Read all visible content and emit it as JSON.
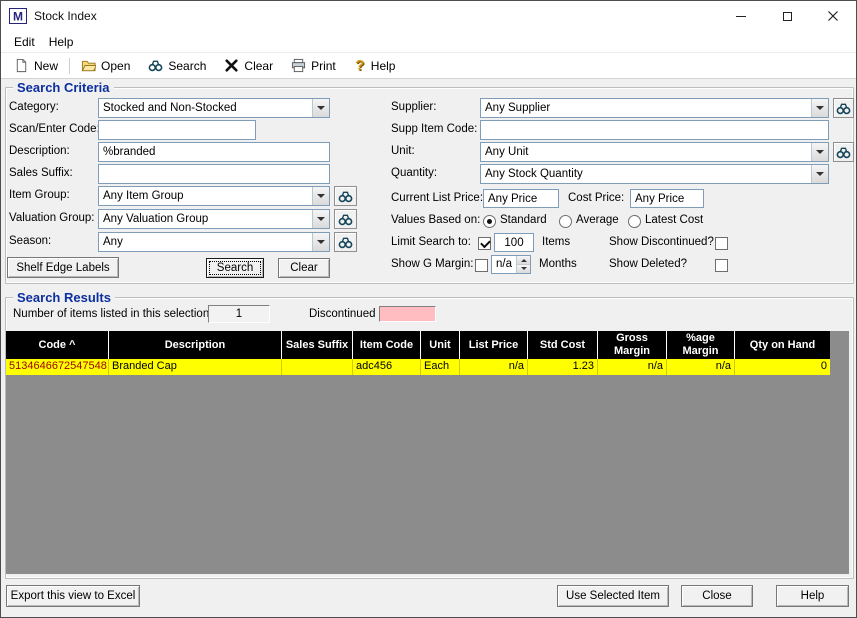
{
  "colors": {
    "title_blue": "#0b2fa0",
    "header_bg": "#000000",
    "row_highlight": "#ffff00",
    "code_text": "#9b0000",
    "discontinued": "#ffbdc2",
    "empty_area": "#8c8c8c"
  },
  "window": {
    "title": "Stock Index"
  },
  "menu": {
    "edit": "Edit",
    "help": "Help"
  },
  "toolbar": {
    "new": "New",
    "open": "Open",
    "search": "Search",
    "clear": "Clear",
    "print": "Print",
    "help": "Help"
  },
  "criteria": {
    "title": "Search Criteria",
    "category_label": "Category:",
    "category_value": "Stocked and Non-Stocked",
    "scan_label": "Scan/Enter Code:",
    "scan_value": "",
    "description_label": "Description:",
    "description_value": "%branded",
    "sales_suffix_label": "Sales Suffix:",
    "sales_suffix_value": "",
    "item_group_label": "Item Group:",
    "item_group_value": "Any Item Group",
    "valuation_group_label": "Valuation Group:",
    "valuation_group_value": "Any Valuation Group",
    "season_label": "Season:",
    "season_value": "Any",
    "supplier_label": "Supplier:",
    "supplier_value": "Any Supplier",
    "supp_item_code_label": "Supp Item Code:",
    "supp_item_code_value": "",
    "unit_label": "Unit:",
    "unit_value": "Any Unit",
    "quantity_label": "Quantity:",
    "quantity_value": "Any Stock Quantity",
    "list_price_label": "Current List Price:",
    "list_price_value": "Any Price",
    "cost_price_label": "Cost Price:",
    "cost_price_value": "Any Price",
    "values_label": "Values Based on:",
    "radio_standard": "Standard",
    "radio_average": "Average",
    "radio_latest": "Latest Cost",
    "standard_selected": true,
    "limit_label": "Limit Search to:",
    "limit_checked": true,
    "limit_value": "100",
    "limit_suffix": "Items",
    "show_discontinued_label": "Show Discontinued?",
    "show_discontinued_checked": false,
    "gmargin_label": "Show G Margin:",
    "gmargin_checked": false,
    "gmargin_value": "n/a",
    "gmargin_suffix": "Months",
    "show_deleted_label": "Show Deleted?",
    "show_deleted_checked": false,
    "shelf_button": "Shelf Edge Labels",
    "search_button": "Search",
    "clear_button": "Clear"
  },
  "results": {
    "title": "Search Results",
    "count_label": "Number of items listed in this selection:",
    "count_value": "1",
    "discontinued_label": "Discontinued",
    "columns": [
      "Code ^",
      "Description",
      "Sales Suffix",
      "Item Code",
      "Unit",
      "List Price",
      "Std Cost",
      "Gross Margin",
      "%age Margin",
      "Qty on Hand"
    ],
    "row": {
      "code": "5134646672547548",
      "description": "Branded Cap",
      "sales_suffix": "",
      "item_code": "adc456",
      "unit": "Each",
      "list_price": "n/a",
      "std_cost": "1.23",
      "gross_margin": "n/a",
      "age_margin": "n/a",
      "qty_on_hand": "0"
    }
  },
  "footer": {
    "export": "Export this view to Excel",
    "use_selected": "Use Selected Item",
    "close": "Close",
    "help": "Help"
  }
}
